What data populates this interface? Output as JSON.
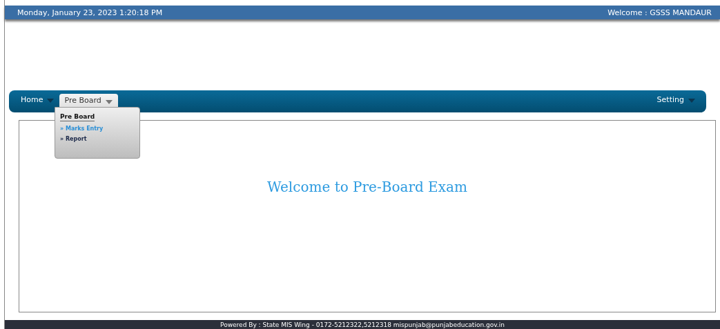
{
  "top_bar": {
    "datetime": "Monday, January 23, 2023 1:20:18 PM",
    "welcome": "Welcome : GSSS MANDAUR"
  },
  "menu": [
    {
      "label": "Home",
      "selected": false
    },
    {
      "label": "Pre Board",
      "selected": true
    }
  ],
  "menu_right": [
    {
      "label": "Setting",
      "selected": false
    }
  ],
  "dropdown": {
    "heading": "Pre Board",
    "items": [
      {
        "label": "» Marks Entry",
        "selected": true
      },
      {
        "label": "» Report",
        "selected": false
      }
    ]
  },
  "content": {
    "title": "Welcome to Pre-Board Exam"
  },
  "footer": "Powered By : State MIS Wing - 0172-5212322,5212318 mispunjab@punjabeducation.gov.in"
}
